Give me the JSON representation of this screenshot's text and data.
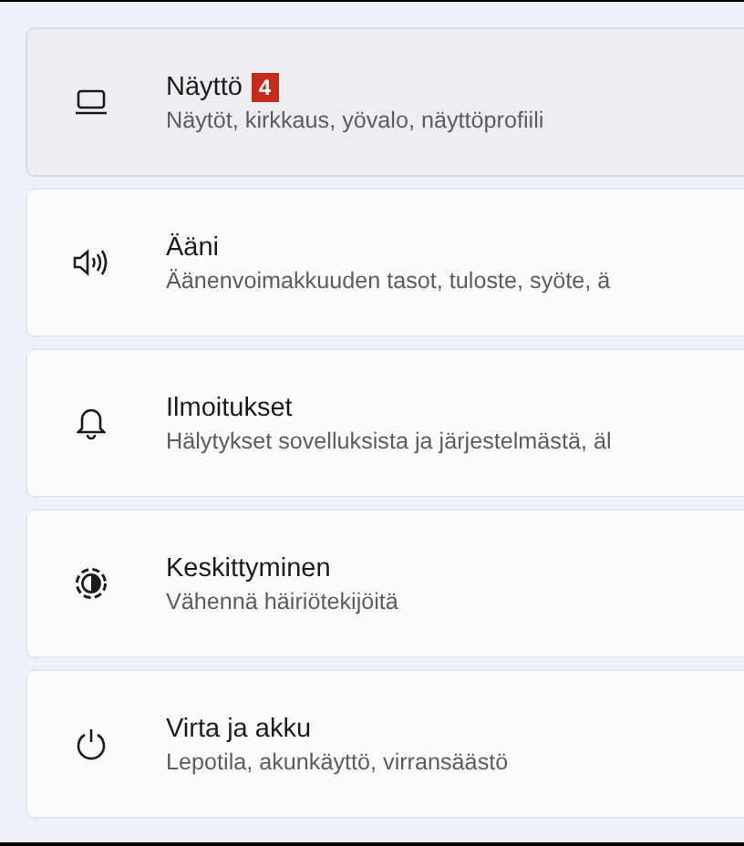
{
  "settings_items": [
    {
      "title": "Näyttö",
      "badge": "4",
      "subtitle": "Näytöt, kirkkaus, yövalo, näyttöprofiili",
      "selected": true
    },
    {
      "title": "Ääni",
      "subtitle": "Äänenvoimakkuuden tasot, tuloste, syöte, ä",
      "selected": false
    },
    {
      "title": "Ilmoitukset",
      "subtitle": "Hälytykset sovelluksista ja järjestelmästä, äl",
      "selected": false
    },
    {
      "title": "Keskittyminen",
      "subtitle": "Vähennä häiriötekijöitä",
      "selected": false
    },
    {
      "title": "Virta ja akku",
      "subtitle": "Lepotila, akunkäyttö, virransäästö",
      "selected": false
    }
  ]
}
